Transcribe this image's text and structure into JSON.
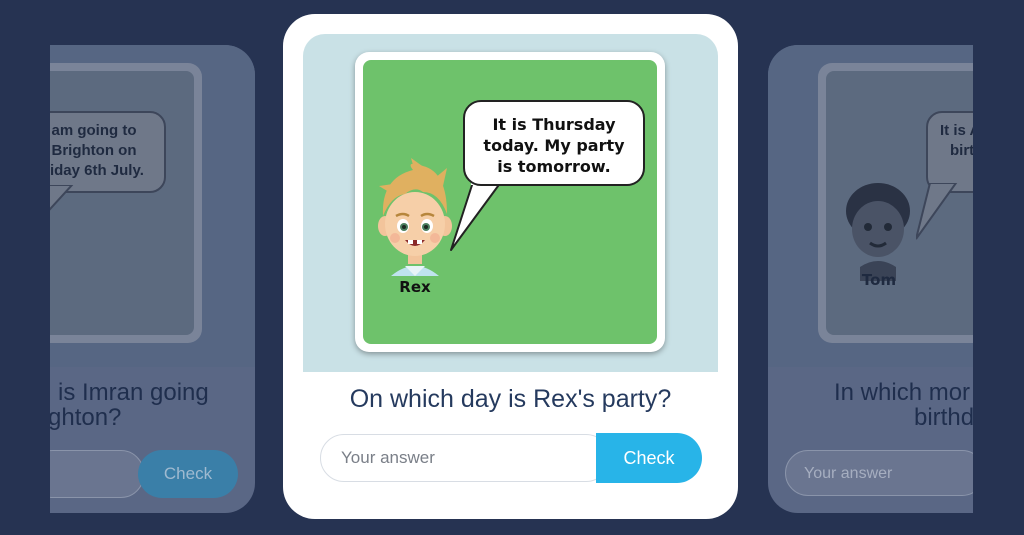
{
  "left_card": {
    "speech_lines": [
      "am going to",
      "Brighton on",
      "riday 6th July."
    ],
    "question_lines": [
      "is Imran going",
      "ghton?"
    ],
    "check_label": "Check"
  },
  "main_card": {
    "speech_lines": [
      "It is Thursday",
      "today. My party",
      "is tomorrow."
    ],
    "character_name": "Rex",
    "question": "On which day is Rex's party?",
    "answer_placeholder": "Your answer",
    "check_label": "Check"
  },
  "right_card": {
    "speech_lines": [
      "It is A",
      "birt"
    ],
    "character_name": "Tom",
    "question_lines": [
      "In which mor",
      "birthd"
    ],
    "answer_placeholder": "Your answer"
  },
  "colors": {
    "background": "#263352",
    "card": "#ffffff",
    "scene_green": "#6ec26b",
    "check_button": "#28b4e8",
    "question_text": "#253a5e"
  }
}
